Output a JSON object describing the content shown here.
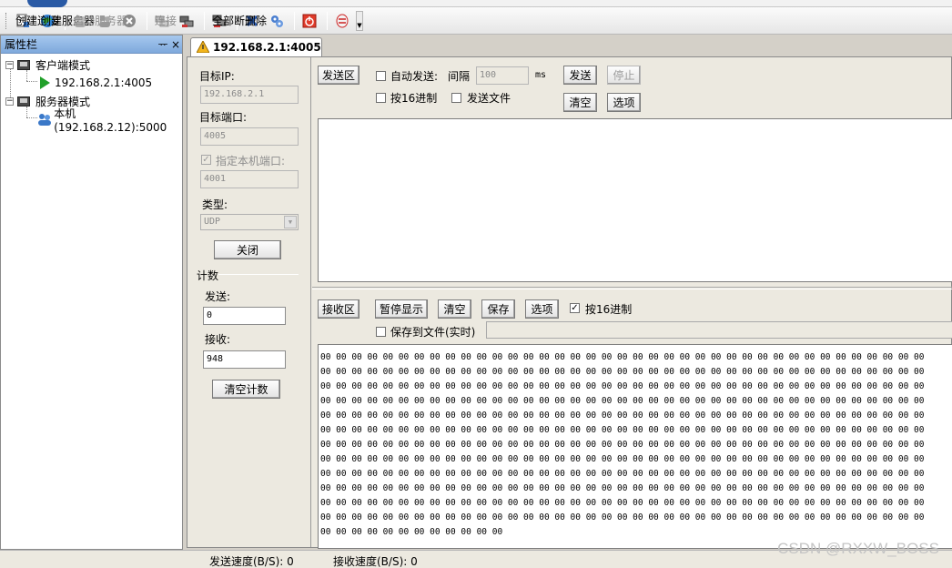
{
  "toolbar": {
    "create_connection": "创建连接",
    "create_server": "创建服务器",
    "start_server": "启动服务器",
    "connect": "连接",
    "disconnect_all": "全部断开",
    "delete": "删除"
  },
  "sidebar": {
    "title": "属性栏",
    "pin": "ᅲ",
    "close": "×",
    "client_mode": "客户端模式",
    "client_item": "192.168.2.1:4005",
    "server_mode": "服务器模式",
    "server_item": "本机(192.168.2.12):5000"
  },
  "tab": {
    "label": "192.168.2.1:4005"
  },
  "left": {
    "target_ip_label": "目标IP:",
    "target_ip": "192.168.2.1",
    "target_port_label": "目标端口:",
    "target_port": "4005",
    "local_port_label": "指定本机端口:",
    "local_port": "4001",
    "type_label": "类型:",
    "type_value": "UDP",
    "close_button": "关闭",
    "count_label": "计数",
    "send_label": "发送:",
    "send_count": "0",
    "recv_label": "接收:",
    "recv_count": "948",
    "clear_count_button": "清空计数"
  },
  "send": {
    "area_button": "发送区",
    "auto_send": "自动发送:",
    "interval_label": "间隔",
    "interval_value": "100",
    "interval_unit": "ms",
    "send_button": "发送",
    "stop_button": "停止",
    "hex_label": "按16进制",
    "send_file_label": "发送文件",
    "clear_button": "清空",
    "options_button": "选项"
  },
  "recv": {
    "area_button": "接收区",
    "pause_button": "暂停显示",
    "clear_button": "清空",
    "save_button": "保存",
    "options_button": "选项",
    "hex_label": "按16进制",
    "save_to_file_label": "保存到文件(实时)",
    "hex_lines": [
      "00 00 00 00 00 00 00 00 00 00 00 00 00 00 00 00 00 00 00 00 00 00 00 00 00 00 00 00 00 00 00 00 00 00 00 00 00 00 00",
      "00 00 00 00 00 00 00 00 00 00 00 00 00 00 00 00 00 00 00 00 00 00 00 00 00 00 00 00 00 00 00 00 00 00 00 00 00 00 00",
      "00 00 00 00 00 00 00 00 00 00 00 00 00 00 00 00 00 00 00 00 00 00 00 00 00 00 00 00 00 00 00 00 00 00 00 00 00 00 00",
      "00 00 00 00 00 00 00 00 00 00 00 00 00 00 00 00 00 00 00 00 00 00 00 00 00 00 00 00 00 00 00 00 00 00 00 00 00 00 00",
      "00 00 00 00 00 00 00 00 00 00 00 00 00 00 00 00 00 00 00 00 00 00 00 00 00 00 00 00 00 00 00 00 00 00 00 00 00 00 00",
      "00 00 00 00 00 00 00 00 00 00 00 00 00 00 00 00 00 00 00 00 00 00 00 00 00 00 00 00 00 00 00 00 00 00 00 00 00 00 00",
      "00 00 00 00 00 00 00 00 00 00 00 00 00 00 00 00 00 00 00 00 00 00 00 00 00 00 00 00 00 00 00 00 00 00 00 00 00 00 00",
      "00 00 00 00 00 00 00 00 00 00 00 00 00 00 00 00 00 00 00 00 00 00 00 00 00 00 00 00 00 00 00 00 00 00 00 00 00 00 00",
      "00 00 00 00 00 00 00 00 00 00 00 00 00 00 00 00 00 00 00 00 00 00 00 00 00 00 00 00 00 00 00 00 00 00 00 00 00 00 00",
      "00 00 00 00 00 00 00 00 00 00 00 00 00 00 00 00 00 00 00 00 00 00 00 00 00 00 00 00 00 00 00 00 00 00 00 00 00 00 00",
      "00 00 00 00 00 00 00 00 00 00 00 00 00 00 00 00 00 00 00 00 00 00 00 00 00 00 00 00 00 00 00 00 00 00 00 00 00 00 00",
      "00 00 00 00 00 00 00 00 00 00 00 00 00 00 00 00 00 00 00 00 00 00 00 00 00 00 00 00 00 00 00 00 00 00 00 00 00 00 00",
      "00 00 00 00 00 00 00 00 00 00 00 00"
    ]
  },
  "status": {
    "send_speed": "发送速度(B/S): 0",
    "recv_speed": "接收速度(B/S): 0"
  },
  "watermark": "CSDN @RXXW_BOSS",
  "icons": {
    "create_connection": "new-connection-icon",
    "create_server": "server-globe-icon",
    "start_server": "start-server-icon",
    "server_people": "people-icon",
    "stop": "stop-circle-icon",
    "connect": "connect-icon",
    "disconnect": "disconnect-icon",
    "delete": "delete-x-icon",
    "settings": "gear-icon",
    "power": "power-icon",
    "help": "help-icon"
  }
}
